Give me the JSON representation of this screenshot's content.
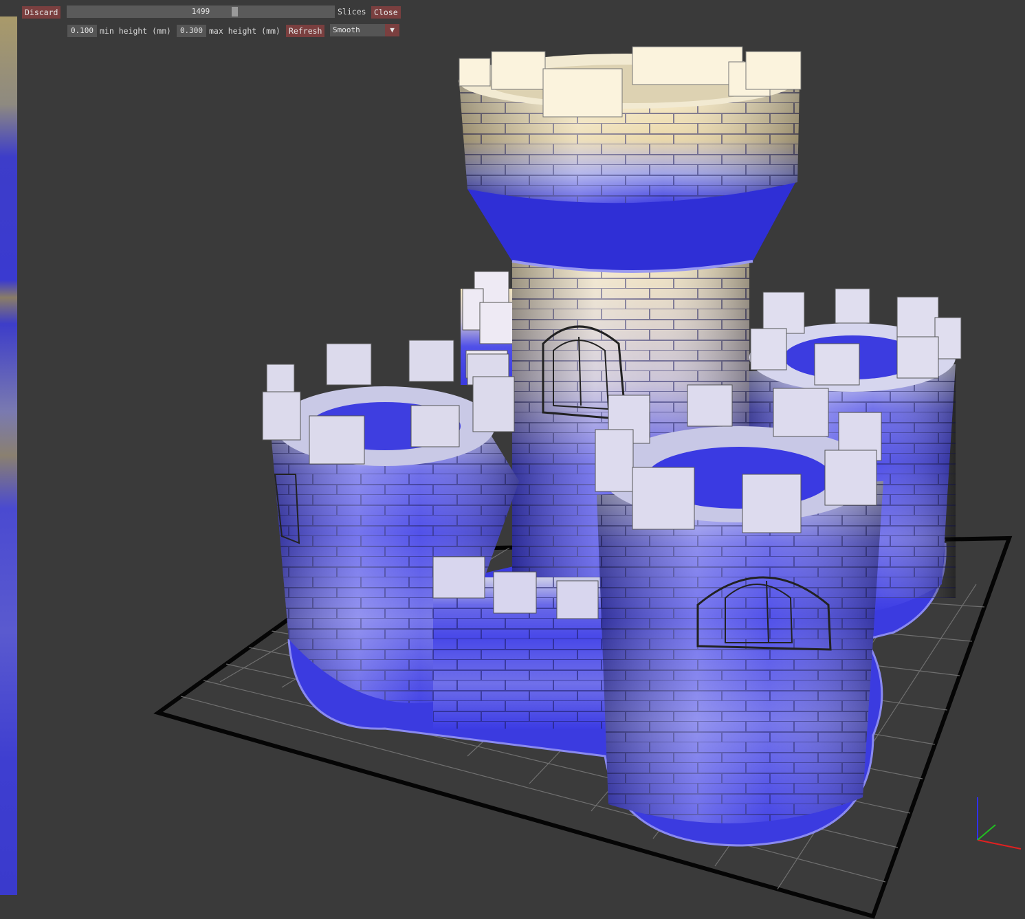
{
  "toolbar": {
    "discard_label": "Discard",
    "slices_value": "1499",
    "slices_label": "Slices",
    "close_label": "Close",
    "min_height_value": "0.100",
    "min_height_label": "min height (mm)",
    "max_height_value": "0.300",
    "max_height_label": "max height (mm)",
    "refresh_label": "Refresh",
    "mode_value": "Smooth",
    "slider_fraction": 0.63
  },
  "colors": {
    "background": "#3a3a3a",
    "button": "#7a3f3f",
    "model_blue": "#3a3ae6",
    "model_light": "#f4e8c8",
    "bed_grid": "#6a6a6a",
    "axis_x": "#e02020",
    "axis_y": "#20c020",
    "axis_z": "#3030ff"
  },
  "icons": {
    "dropdown": "triangle-down-icon",
    "axes": "xyz-axes-icon"
  }
}
